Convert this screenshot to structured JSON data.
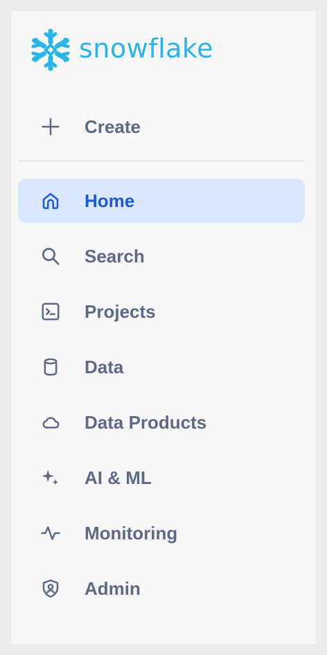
{
  "brand": {
    "name": "snowflake",
    "color": "#29b5e8"
  },
  "create": {
    "label": "Create",
    "icon": "plus-icon"
  },
  "nav": {
    "items": [
      {
        "label": "Home",
        "icon": "home-icon",
        "active": true
      },
      {
        "label": "Search",
        "icon": "search-icon",
        "active": false
      },
      {
        "label": "Projects",
        "icon": "terminal-icon",
        "active": false
      },
      {
        "label": "Data",
        "icon": "database-icon",
        "active": false
      },
      {
        "label": "Data Products",
        "icon": "cloud-icon",
        "active": false
      },
      {
        "label": "AI & ML",
        "icon": "sparkle-icon",
        "active": false
      },
      {
        "label": "Monitoring",
        "icon": "activity-icon",
        "active": false
      },
      {
        "label": "Admin",
        "icon": "shield-user-icon",
        "active": false
      }
    ]
  },
  "colors": {
    "active_background": "#dbe7fc",
    "active_text": "#1f5ad6",
    "default_text": "#5d6a85",
    "panel_background": "#f7f7f7"
  }
}
